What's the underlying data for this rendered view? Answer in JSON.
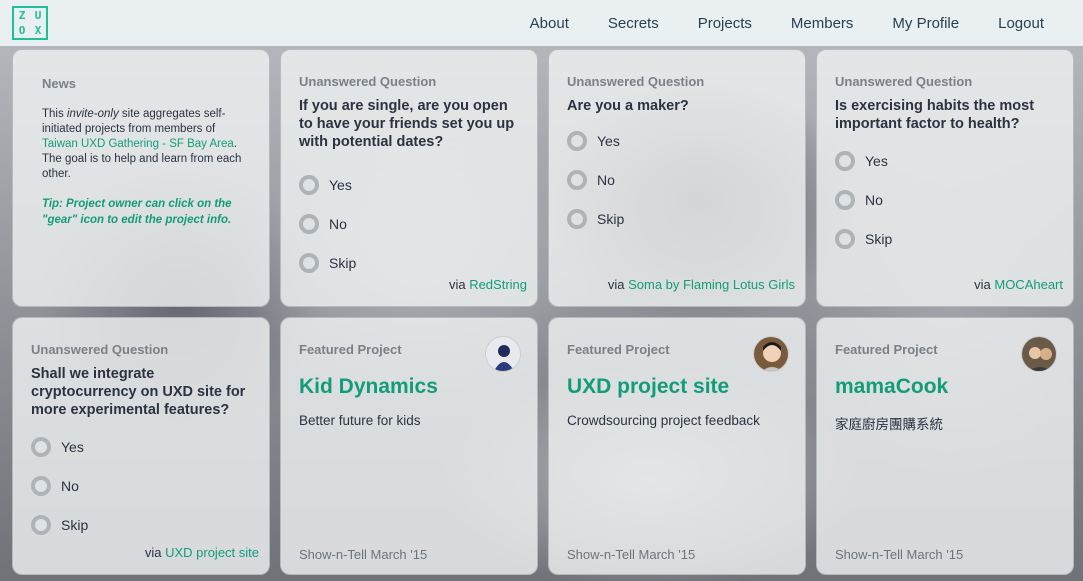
{
  "nav": {
    "logo_letters": [
      "Z",
      "U",
      "O",
      "X"
    ],
    "items": [
      "About",
      "Secrets",
      "Projects",
      "Members",
      "My Profile",
      "Logout"
    ]
  },
  "news": {
    "title": "News",
    "body_prefix": "This ",
    "body_em": "invite-only",
    "body_mid": " site aggregates self-initiated projects from members of ",
    "body_link": "Taiwan UXD Gathering - SF Bay Area",
    "body_suffix": ". The goal is to help and learn from each other.",
    "tip": "Tip: Project owner can click on the \"gear\" icon to edit the project info."
  },
  "questions": [
    {
      "title": "Unanswered Question",
      "question": "If you are single, are you open to have your friends set you up with potential dates?",
      "options": [
        "Yes",
        "No",
        "Skip"
      ],
      "via_prefix": "via ",
      "via": "RedString"
    },
    {
      "title": "Unanswered Question",
      "question": "Are you a maker?",
      "options": [
        "Yes",
        "No",
        "Skip"
      ],
      "via_prefix": "via ",
      "via": "Soma by Flaming Lotus Girls"
    },
    {
      "title": "Unanswered Question",
      "question": "Is exercising habits the most important factor to health?",
      "options": [
        "Yes",
        "No",
        "Skip"
      ],
      "via_prefix": "via ",
      "via": "MOCAheart"
    },
    {
      "title": "Unanswered Question",
      "question": "Shall we integrate cryptocurrency on UXD site for more experimental features?",
      "options": [
        "Yes",
        "No",
        "Skip"
      ],
      "via_prefix": "via ",
      "via": "UXD project site"
    }
  ],
  "projects": [
    {
      "title": "Featured Project",
      "name": "Kid Dynamics",
      "desc": "Better future for kids",
      "foot": "Show-n-Tell March '15"
    },
    {
      "title": "Featured Project",
      "name": "UXD project site",
      "desc": "Crowdsourcing project feedback",
      "foot": "Show-n-Tell March '15"
    },
    {
      "title": "Featured Project",
      "name": "mamaCook",
      "desc": "家庭廚房團購系統",
      "foot": "Show-n-Tell March '15"
    }
  ],
  "colors": {
    "accent": "#139c7a",
    "logo": "#1fbf9a"
  }
}
